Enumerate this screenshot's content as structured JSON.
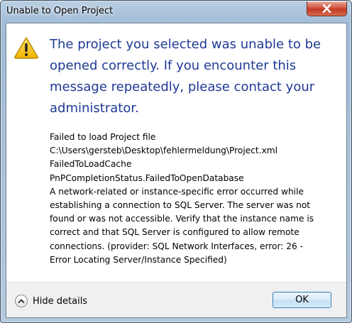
{
  "window": {
    "title": "Unable to Open Project",
    "close_icon": "close-icon"
  },
  "dialog": {
    "icon": "warning-icon",
    "main_instruction": "The project you selected was unable to be opened correctly. If you encounter this message repeatedly, please contact your administrator.",
    "details_lines": [
      "Failed to load Project file",
      "C:\\Users\\gersteb\\Desktop\\fehlermeldung\\Project.xml",
      "FailedToLoadCache",
      "PnPCompletionStatus.FailedToOpenDatabase",
      "A network-related or instance-specific error occurred while",
      "establishing a connection to SQL Server. The server was not",
      "found or was not accessible. Verify that the instance name is",
      "correct and that SQL Server is configured to allow remote",
      "connections. (provider: SQL Network Interfaces, error: 26 -",
      "Error Locating Server/Instance Specified)"
    ]
  },
  "footer": {
    "toggle_icon": "chevron-up-icon",
    "toggle_label": "Hide details",
    "ok_label": "OK"
  },
  "colors": {
    "instruction_text": "#1f3a96",
    "close_button": "#c23b25",
    "ok_border": "#3c7fb1"
  }
}
